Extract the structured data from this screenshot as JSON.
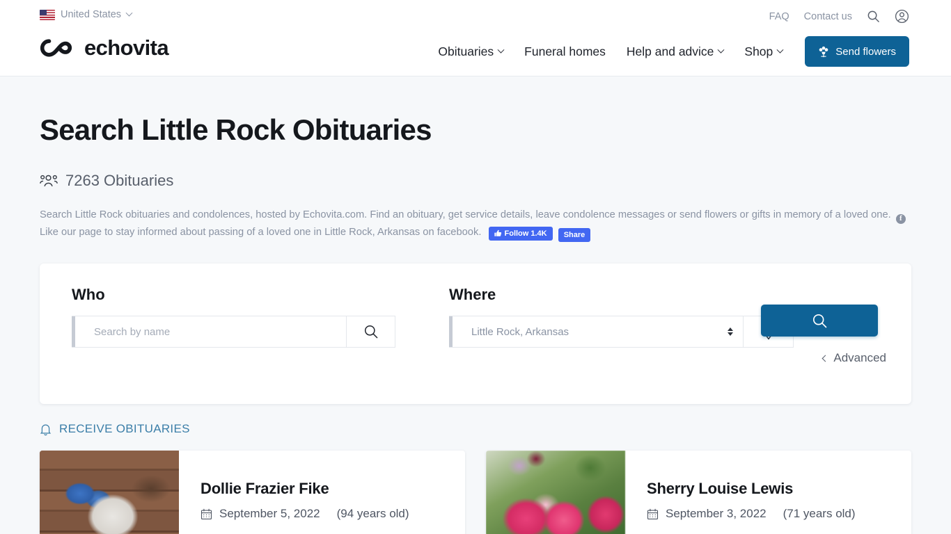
{
  "header": {
    "country": {
      "label": "United States",
      "flag_icon": "us-flag-icon",
      "chevron_icon": "chevron-down-icon"
    },
    "top_links": [
      {
        "label": "FAQ",
        "name": "faq"
      },
      {
        "label": "Contact us",
        "name": "contact-us"
      }
    ],
    "top_icons": [
      {
        "name": "search-icon"
      },
      {
        "name": "user-account-icon"
      }
    ],
    "logo": {
      "text": "echovita",
      "icon": "infinity-logo-icon"
    },
    "nav": [
      {
        "label": "Obituaries",
        "has_chevron": true
      },
      {
        "label": "Funeral homes",
        "has_chevron": false
      },
      {
        "label": "Help and advice",
        "has_chevron": true
      },
      {
        "label": "Shop",
        "has_chevron": true
      }
    ],
    "send_flowers_button": {
      "label": "Send flowers",
      "icon": "flower-bouquet-icon",
      "color": "#0e6296"
    }
  },
  "main": {
    "title": "Search Little Rock Obituaries",
    "count": {
      "icon": "people-group-icon",
      "text": "7263 Obituaries"
    },
    "description": {
      "part1": "Search Little Rock obituaries and condolences, hosted by Echovita.com. Find an obituary, get service details, leave condolence messages or send flowers or gifts in memory of a loved one.",
      "part2": "Like our page to stay informed about passing of a loved one in Little Rock, Arkansas on facebook.",
      "facebook_icon": "facebook-icon",
      "follow_button": {
        "label": "Follow 1.4K",
        "icon": "thumbs-up-icon",
        "color": "#4267f2"
      },
      "share_button": {
        "label": "Share",
        "color": "#4267f2"
      }
    }
  },
  "search": {
    "who": {
      "label": "Who",
      "placeholder": "Search by name",
      "value": "",
      "icon": "search-icon"
    },
    "where": {
      "label": "Where",
      "selected": "Little Rock, Arkansas",
      "options": [
        "Little Rock, Arkansas"
      ],
      "icon": "map-pin-icon",
      "arrows_icon": "select-arrows-icon"
    },
    "submit": {
      "icon": "search-icon",
      "color": "#0e6296"
    },
    "advanced": {
      "label": "Advanced",
      "icon": "chevron-left-icon"
    }
  },
  "receive": {
    "label": "RECEIVE OBITUARIES",
    "icon": "bell-icon",
    "color": "#3b7ea8"
  },
  "obituaries": [
    {
      "name": "Dollie Frazier Fike",
      "date": "September 5, 2022",
      "age": "(94 years old)",
      "date_icon": "calendar-icon",
      "photo": "blue-butterfly-on-wood"
    },
    {
      "name": "Sherry Louise Lewis",
      "date": "September 3, 2022",
      "age": "(71 years old)",
      "date_icon": "calendar-icon",
      "photo": "pink-tulips"
    }
  ]
}
